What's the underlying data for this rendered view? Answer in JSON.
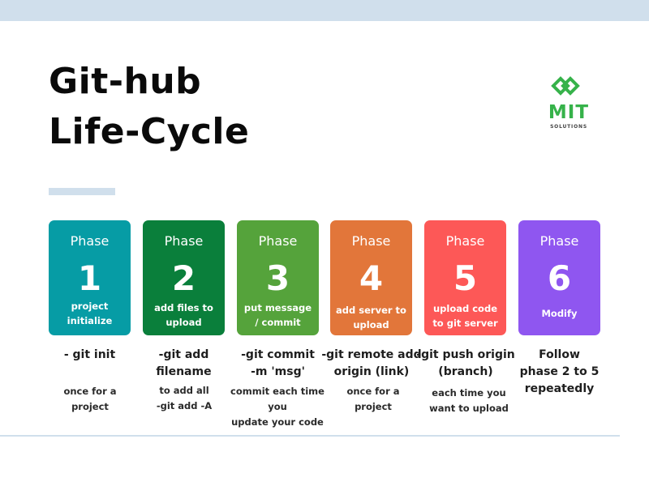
{
  "title": {
    "line1": "Git-hub",
    "line2": "Life-Cycle"
  },
  "logo": {
    "text": "MIT",
    "subtext": "SOLUTIONS"
  },
  "colors": {
    "band": "#d0dfec",
    "logo_green": "#36b24a",
    "phase1": "#069ca5",
    "phase2": "#0a7f3b",
    "phase3": "#55a33b",
    "phase4": "#e2763a",
    "phase5": "#fd5857",
    "phase6": "#8f56f0"
  },
  "phases": [
    {
      "label": "Phase",
      "number": "1",
      "desc": [
        "project",
        "initialize"
      ],
      "command": [
        "- git init"
      ],
      "note": [
        "once for a",
        "project"
      ]
    },
    {
      "label": "Phase",
      "number": "2",
      "desc": [
        "add files to",
        "upload"
      ],
      "command": [
        "-git add",
        "filename"
      ],
      "note": [
        "to add all",
        "-git add -A"
      ]
    },
    {
      "label": "Phase",
      "number": "3",
      "desc": [
        "put message",
        "/ commit"
      ],
      "command": [
        "-git commit",
        "-m 'msg'"
      ],
      "note": [
        "commit each time you",
        "update your code"
      ]
    },
    {
      "label": "Phase",
      "number": "4",
      "desc": [
        "add server to",
        "upload"
      ],
      "command": [
        "-git remote add",
        "origin (link)"
      ],
      "note": [
        "once for a",
        "project"
      ]
    },
    {
      "label": "Phase",
      "number": "5",
      "desc": [
        "upload code",
        "to git server"
      ],
      "command": [
        "-git push origin",
        "(branch)"
      ],
      "note": [
        "each time you",
        "want to upload"
      ]
    },
    {
      "label": "Phase",
      "number": "6",
      "desc": [
        "Modify"
      ],
      "command": [
        "Follow",
        "phase 2 to 5",
        "repeatedly"
      ],
      "note": []
    }
  ]
}
